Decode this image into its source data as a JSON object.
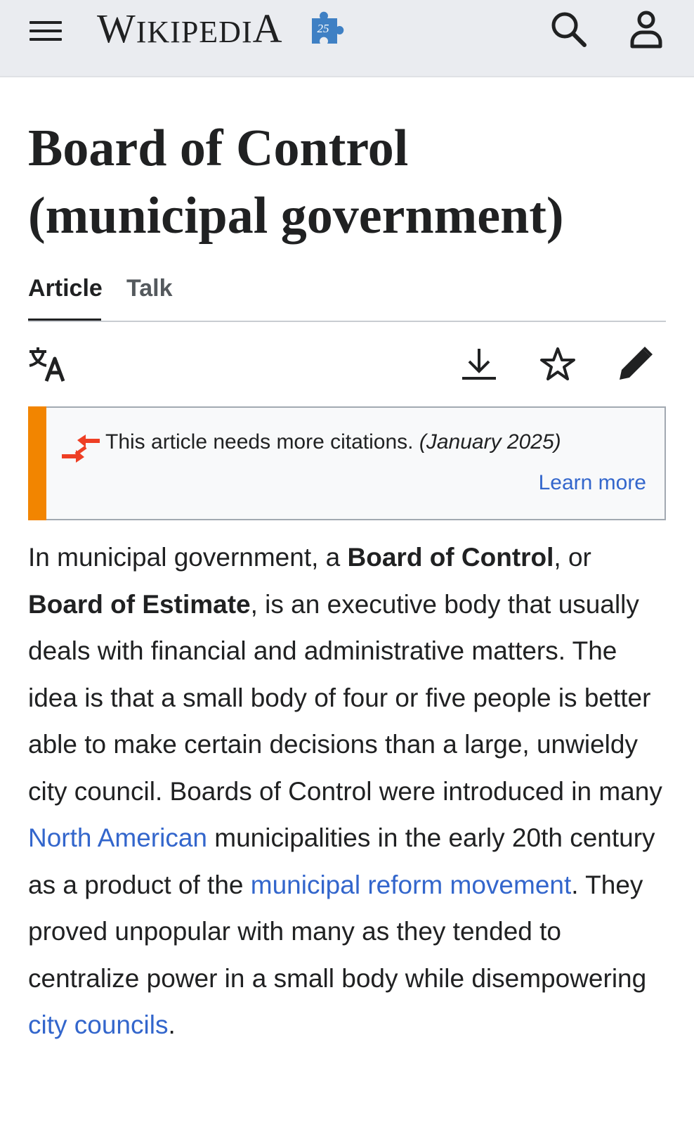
{
  "header": {
    "wordmark_first": "W",
    "wordmark_mid": "IKIPEDI",
    "wordmark_last": "A",
    "anniversary_badge": "25",
    "icons": [
      "menu-icon",
      "search-icon",
      "user-icon"
    ]
  },
  "page": {
    "title_line1": "Board of Control",
    "title_line2": "(municipal government)"
  },
  "tabs": [
    {
      "label": "Article",
      "active": true
    },
    {
      "label": "Talk",
      "active": false
    }
  ],
  "toolbar": {
    "icons": [
      "language-icon",
      "download-icon",
      "star-icon",
      "edit-icon"
    ]
  },
  "notice": {
    "text": "This article needs more citations.",
    "date": "(January 2025)",
    "link": "Learn more",
    "accent_color": "#f28500"
  },
  "article": {
    "p1_start": "In municipal government, a ",
    "bold1": "Board of Control",
    "p1_mid": ", or ",
    "bold2": "Board of Estimate",
    "p1_rest": ", is an executive body that usually deals with financial and administrative matters. The idea is that a small body of four or five people is better able to make certain decisions than a large, unwieldy city council. Boards of Control were introduced in many ",
    "link1": "North American",
    "p1_after_link1": " municipalities in the early 20th century as a product of the ",
    "link2": "municipal reform movement",
    "p1_after_link2": ". They proved unpopular with many as they tended to centralize power in a small body while disempowering ",
    "link3": "city councils",
    "p1_end": "."
  },
  "colors": {
    "link": "#3366cc",
    "header_bg": "#eaecf0",
    "text": "#202122"
  }
}
